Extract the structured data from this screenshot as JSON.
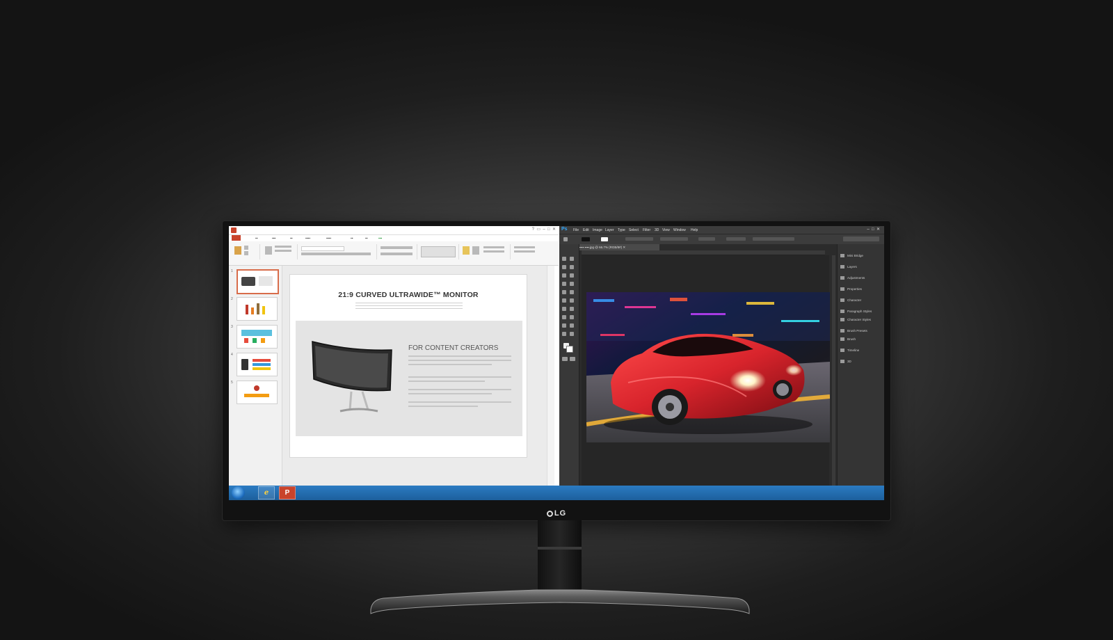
{
  "brand": "LG",
  "powerpoint": {
    "slide_title": "21:9 CURVED ULTRAWIDE™ MONITOR",
    "slide_subtitle": "FOR CONTENT CREATORS",
    "slide_numbers": [
      "1",
      "2",
      "3",
      "4",
      "5"
    ]
  },
  "taskbar": {
    "start": "start-orb-icon",
    "ie": "internet-explorer-icon",
    "ppt": "powerpoint-icon",
    "ie_glyph": "e",
    "ppt_glyph": "P"
  },
  "photoshop": {
    "logo": "Ps",
    "menu": [
      "File",
      "Edit",
      "Image",
      "Layer",
      "Type",
      "Select",
      "Filter",
      "3D",
      "View",
      "Window",
      "Help"
    ],
    "panels": [
      "Mini Bridge",
      "Layers",
      "Adjustments",
      "Properties",
      "Character",
      "Paragraph Styles",
      "Character Styles",
      "Brush Presets",
      "Brush",
      "Timeline",
      "3D"
    ]
  },
  "colors": {
    "ppt_accent": "#c9432b",
    "ps_accent": "#31a8ff",
    "taskbar": "#1d5f9c",
    "car": "#d8242c"
  }
}
